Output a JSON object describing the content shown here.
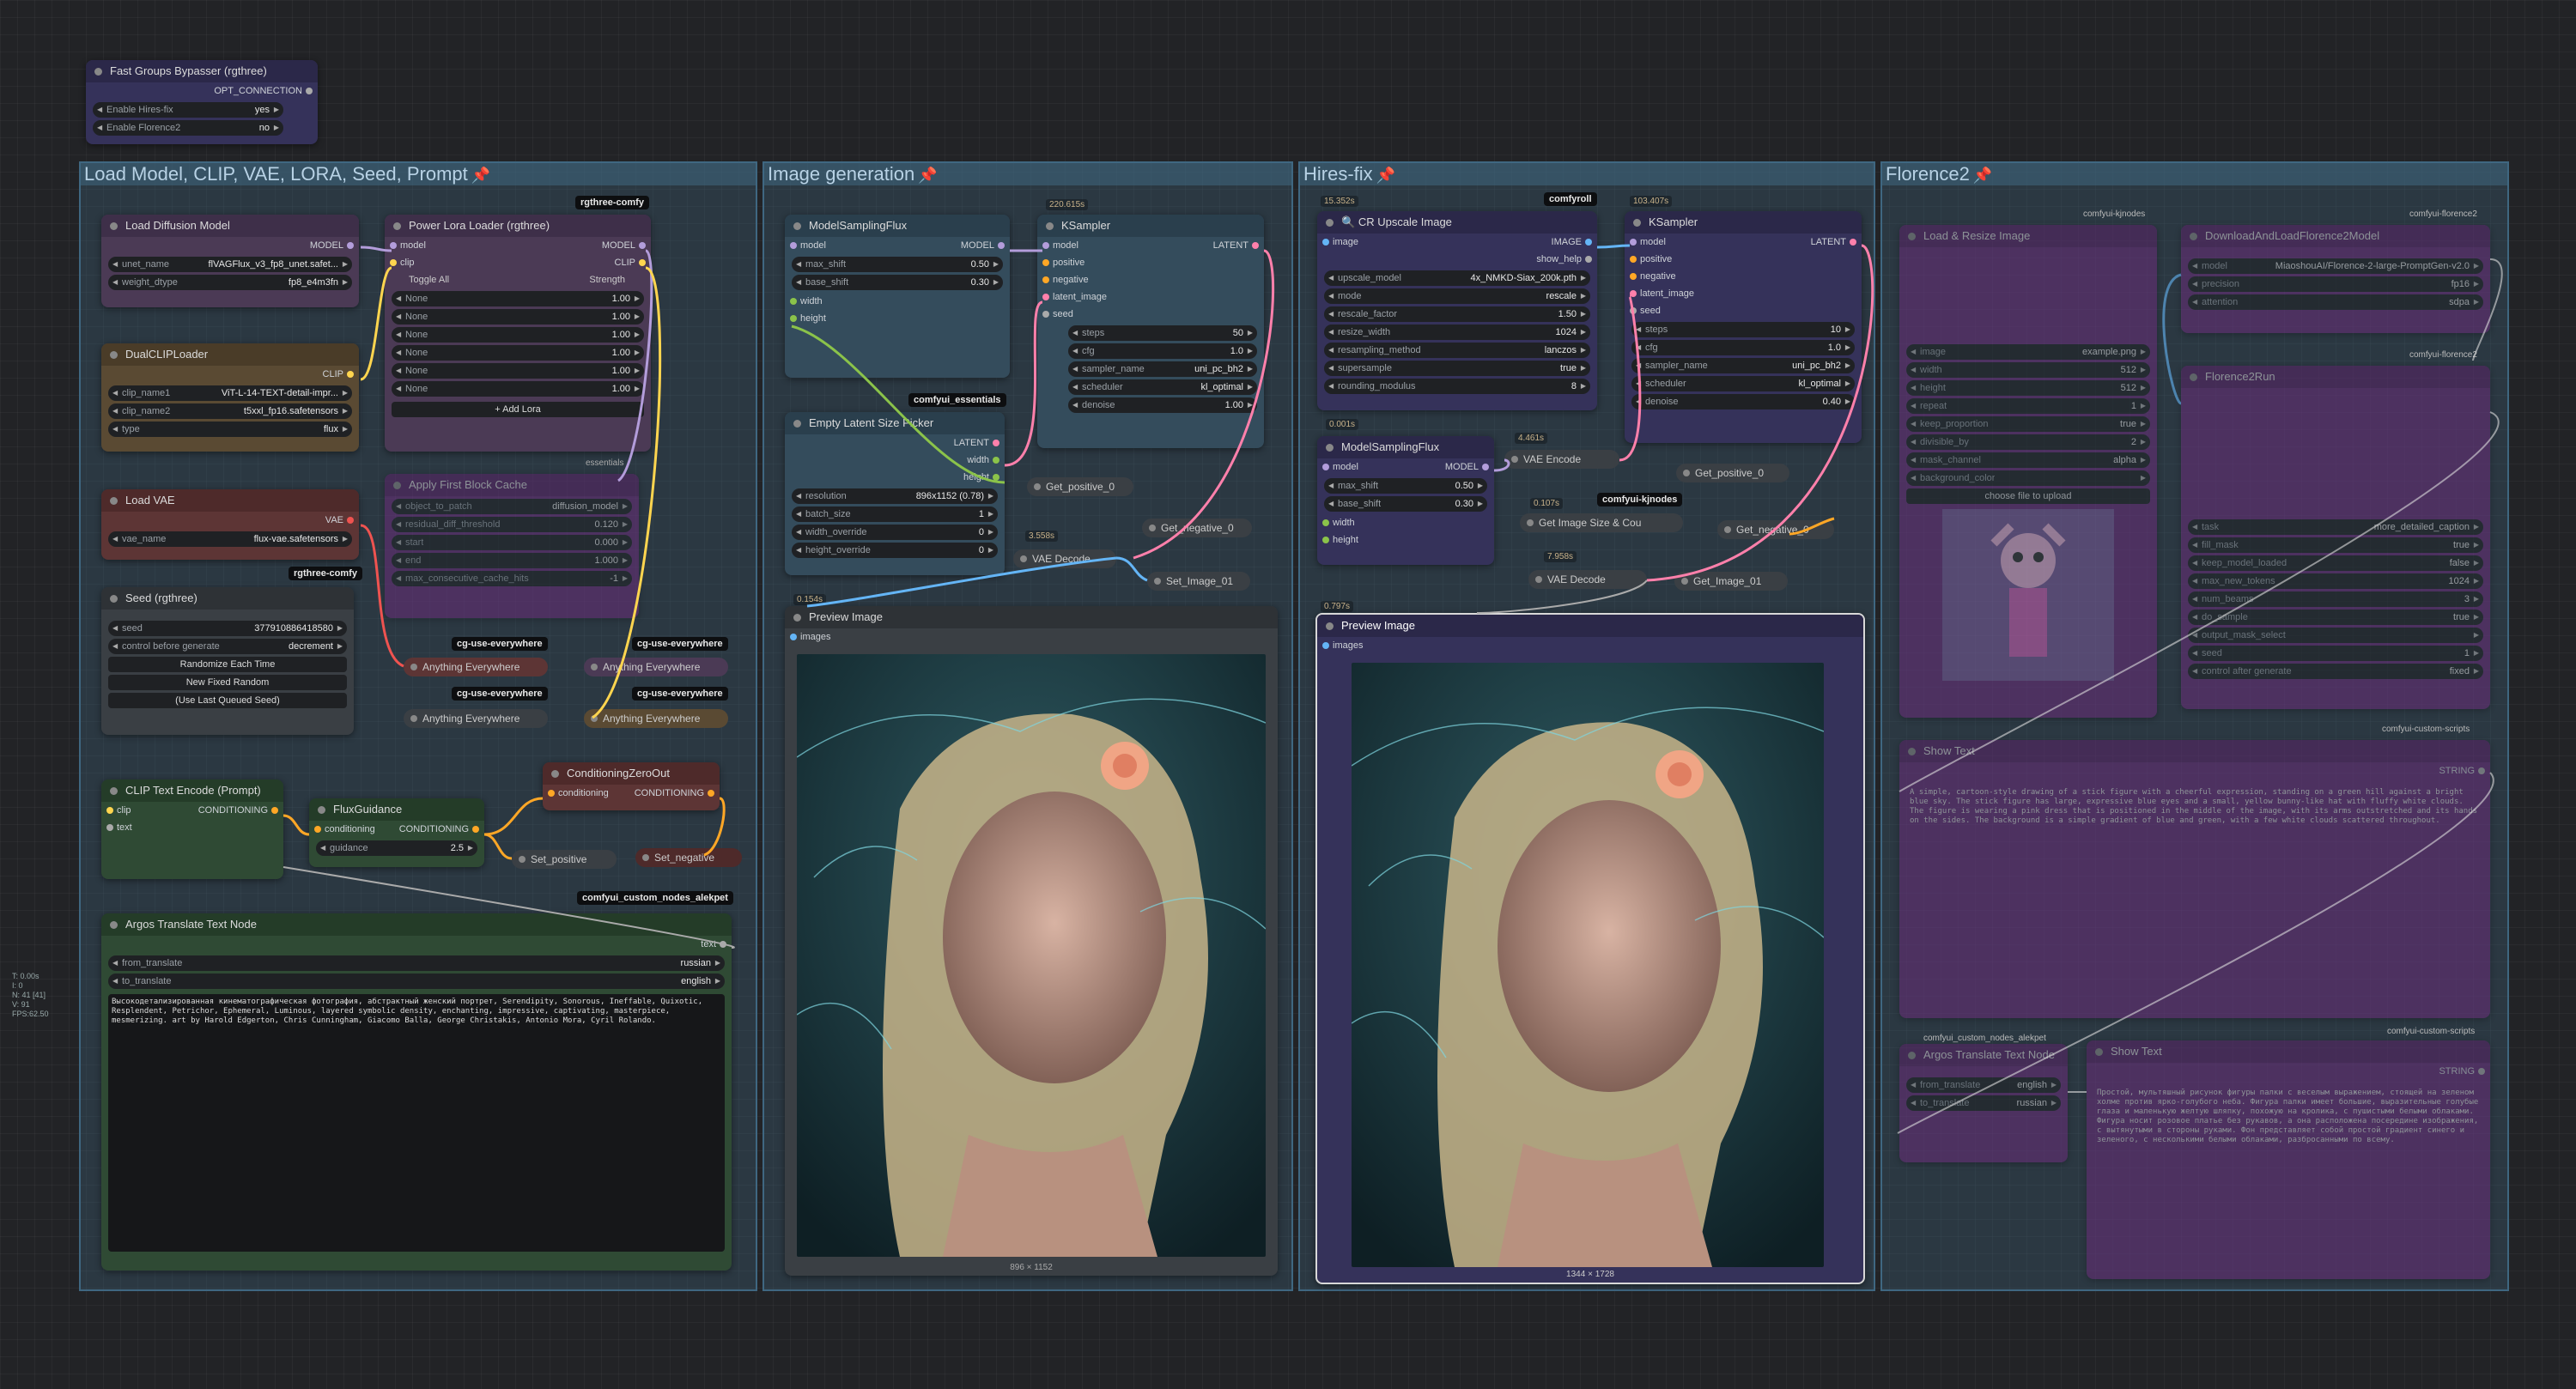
{
  "stats": [
    "T: 0.00s",
    "I: 0",
    "N: 41 [41]",
    "V: 91",
    "FPS:62.50"
  ],
  "groups": {
    "load": "Load Model, CLIP, VAE, LORA, Seed, Prompt",
    "gen": "Image generation",
    "hires": "Hires-fix",
    "florence": "Florence2"
  },
  "bypasser": {
    "title": "Fast Groups Bypasser (rgthree)",
    "out": "OPT_CONNECTION",
    "items": [
      {
        "label": "Enable Hires-fix",
        "value": "yes"
      },
      {
        "label": "Enable Florence2",
        "value": "no"
      }
    ]
  },
  "diffusion": {
    "title": "Load Diffusion Model",
    "out": "MODEL",
    "w": [
      [
        "unet_name",
        "flVAGFlux_v3_fp8_unet.safet..."
      ],
      [
        "weight_dtype",
        "fp8_e4m3fn"
      ]
    ]
  },
  "dualclip": {
    "title": "DualCLIPLoader",
    "out": "CLIP",
    "w": [
      [
        "clip_name1",
        "ViT-L-14-TEXT-detail-impr..."
      ],
      [
        "clip_name2",
        "t5xxl_fp16.safetensors"
      ],
      [
        "type",
        "flux"
      ]
    ]
  },
  "vae": {
    "title": "Load VAE",
    "out": "VAE",
    "w": [
      [
        "vae_name",
        "flux-vae.safetensors"
      ]
    ]
  },
  "seed": {
    "title": "Seed (rgthree)",
    "w": [
      [
        "seed",
        "377910886418580"
      ],
      [
        "control before generate",
        "decrement"
      ]
    ],
    "btns": [
      "Randomize Each Time",
      "New Fixed Random",
      "(Use Last Queued Seed)"
    ]
  },
  "lora": {
    "title": "Power Lora Loader (rgthree)",
    "in": [
      "model",
      "clip"
    ],
    "out": [
      "MODEL",
      "CLIP"
    ],
    "toggle": "Toggle All",
    "strength": "Strength",
    "rows": [
      "None",
      "None",
      "None",
      "None",
      "None",
      "None"
    ],
    "rowval": "1.00",
    "add": "+ Add Lora"
  },
  "fbc": {
    "title": "Apply First Block Cache",
    "w": [
      [
        "model",
        ""
      ],
      [
        "object_to_patch",
        "diffusion_model"
      ],
      [
        "residual_diff_threshold",
        "0.120"
      ],
      [
        "start",
        "0.000"
      ],
      [
        "end",
        "1.000"
      ],
      [
        "max_consecutive_cache_hits",
        "-1"
      ]
    ]
  },
  "anything": [
    "Anything Everywhere",
    "Anything Everywhere",
    "Anything Everywhere",
    "Anything Everywhere"
  ],
  "badges": {
    "rgthree": "rgthree-comfy",
    "cg": "cg-use-everywhere",
    "essentials": "comfyui_essentials",
    "comfyroll": "comfyroll",
    "kjnodes": "comfyui-kjnodes",
    "aleksei": "comfyui_custom_nodes_alekpet",
    "florence2": "comfyui-florence2",
    "customscripts": "comfyui-custom-scripts",
    "essentials2": "essentials"
  },
  "clipenc": {
    "title": "CLIP Text Encode (Prompt)",
    "in": [
      "clip",
      "text"
    ],
    "out": "CONDITIONING"
  },
  "fluxguid": {
    "title": "FluxGuidance",
    "in": "conditioning",
    "out": "CONDITIONING",
    "w": [
      [
        "guidance",
        "2.5"
      ]
    ]
  },
  "czo": {
    "title": "ConditioningZeroOut",
    "in": "conditioning",
    "out": "CONDITIONING"
  },
  "setpos": "Set_positive",
  "setneg": "Set_negative",
  "argos": {
    "title": "Argos Translate Text Node",
    "out": "text",
    "w": [
      [
        "from_translate",
        "russian"
      ],
      [
        "to_translate",
        "english"
      ]
    ],
    "text": "Высокодетализированная кинематографическая фотография, абстрактный женский портрет, Serendipity, Sonorous, Ineffable, Quixotic, Resplendent, Petrichor, Ephemeral, Luminous, layered symbolic density, enchanting, impressive, captivating, masterpiece, mesmerizing. art by Harold Edgerton, Chris Cunningham, Giacomo Balla, George Christakis, Antonio Mora, Cyril Rolando."
  },
  "msf1": {
    "title": "ModelSamplingFlux",
    "in": [
      "model",
      "width",
      "height"
    ],
    "out": "MODEL",
    "w": [
      [
        "max_shift",
        "0.50"
      ],
      [
        "base_shift",
        "0.30"
      ]
    ]
  },
  "ks1": {
    "title": "KSampler",
    "in": [
      "model",
      "positive",
      "negative",
      "latent_image",
      "seed"
    ],
    "out": "LATENT",
    "w": [
      [
        "steps",
        "50"
      ],
      [
        "cfg",
        "1.0"
      ],
      [
        "sampler_name",
        "uni_pc_bh2"
      ],
      [
        "scheduler",
        "kl_optimal"
      ],
      [
        "denoise",
        "1.00"
      ]
    ],
    "time": "220.615s"
  },
  "elsp": {
    "title": "Empty Latent Size Picker",
    "out": [
      "LATENT",
      "width",
      "height"
    ],
    "w": [
      [
        "resolution",
        "896x1152 (0.78)"
      ],
      [
        "batch_size",
        "1"
      ],
      [
        "width_override",
        "0"
      ],
      [
        "height_override",
        "0"
      ]
    ]
  },
  "getpos0": "Get_positive_0",
  "getneg0": "Get_negative_0",
  "vaedec1": {
    "title": "VAE Decode",
    "time": "3.558s"
  },
  "setimg": "Set_Image_01",
  "prev1": {
    "title": "Preview Image",
    "in": "images",
    "size": "896 × 1152",
    "time": "0.154s"
  },
  "cr": {
    "title": "CR Upscale Image",
    "in": "image",
    "out": [
      "IMAGE",
      "show_help"
    ],
    "w": [
      [
        "upscale_model",
        "4x_NMKD-Siax_200k.pth"
      ],
      [
        "mode",
        "rescale"
      ],
      [
        "rescale_factor",
        "1.50"
      ],
      [
        "resize_width",
        "1024"
      ],
      [
        "resampling_method",
        "lanczos"
      ],
      [
        "supersample",
        "true"
      ],
      [
        "rounding_modulus",
        "8"
      ]
    ],
    "time": "15.352s"
  },
  "msf2": {
    "title": "ModelSamplingFlux",
    "in": [
      "model",
      "width",
      "height"
    ],
    "out": "MODEL",
    "w": [
      [
        "max_shift",
        "0.50"
      ],
      [
        "base_shift",
        "0.30"
      ]
    ],
    "time": "0.001s"
  },
  "ks2": {
    "title": "KSampler",
    "in": [
      "model",
      "positive",
      "negative",
      "latent_image",
      "seed"
    ],
    "out": "LATENT",
    "w": [
      [
        "steps",
        "10"
      ],
      [
        "cfg",
        "1.0"
      ],
      [
        "sampler_name",
        "uni_pc_bh2"
      ],
      [
        "scheduler",
        "kl_optimal"
      ],
      [
        "denoise",
        "0.40"
      ]
    ],
    "time": "103.407s"
  },
  "vaeenc": {
    "title": "VAE Encode",
    "time": "4.461s"
  },
  "getimgsize": {
    "title": "Get Image Size & Cou",
    "time": "0.107s"
  },
  "vaedec2": {
    "title": "VAE Decode",
    "time": "7.958s"
  },
  "getimg01": "Get_Image_01",
  "getpos2": "Get_positive_0",
  "getneg2": "Get_negative_0",
  "prev2": {
    "title": "Preview Image",
    "in": "images",
    "size": "1344 × 1728",
    "time": "0.797s"
  },
  "flo": {
    "load": {
      "title": "Load & Resize Image",
      "w": [
        [
          "image",
          "example.png"
        ],
        [
          "width",
          "512"
        ],
        [
          "height",
          "512"
        ],
        [
          "repeat",
          "1"
        ],
        [
          "keep_proportion",
          "true"
        ],
        [
          "divisible_by",
          "2"
        ],
        [
          "mask_channel",
          "alpha"
        ],
        [
          "background_color",
          ""
        ]
      ],
      "upload": "choose file to upload"
    },
    "dl": {
      "title": "DownloadAndLoadFlorence2Model",
      "w": [
        [
          "model",
          "MiaoshouAI/Florence-2-large-PromptGen-v2.0"
        ],
        [
          "precision",
          "fp16"
        ],
        [
          "attention",
          "sdpa"
        ]
      ]
    },
    "run": {
      "title": "Florence2Run",
      "w": [
        [
          "task",
          "more_detailed_caption"
        ],
        [
          "fill_mask",
          "true"
        ],
        [
          "keep_model_loaded",
          "false"
        ],
        [
          "max_new_tokens",
          "1024"
        ],
        [
          "num_beams",
          "3"
        ],
        [
          "do_sample",
          "true"
        ],
        [
          "output_mask_select",
          ""
        ],
        [
          "seed",
          "1"
        ],
        [
          "control after generate",
          "fixed"
        ]
      ]
    },
    "show1": {
      "title": "Show Text",
      "out": "STRING",
      "text": "A simple, cartoon-style drawing of a stick figure with a cheerful expression, standing on a green hill against a bright blue sky. The stick figure has large, expressive blue eyes and a small, yellow bunny-like hat with fluffy white clouds. The figure is wearing a pink dress that is positioned in the middle of the image, with its arms outstretched and its hands on the sides. The background is a simple gradient of blue and green, with a few white clouds scattered throughout."
    },
    "argos2": {
      "title": "Argos Translate Text Node",
      "w": [
        [
          "from_translate",
          "english"
        ],
        [
          "to_translate",
          "russian"
        ]
      ]
    },
    "show2": {
      "title": "Show Text",
      "out": "STRING",
      "text": "Простой, мультяшный рисунок фигуры палки с веселым выражением, стоящей на зеленом холме против ярко-голубого неба. Фигура палки имеет большие, выразительные голубые глаза и маленькую желтую шляпку, похожую на кролика, с пушистыми белыми облаками. Фигура носит розовое платье без рукавов, а она расположена посередине изображения, с вытянутыми в стороны руками. Фон представляет собой простой градиент синего и зеленого, с несколькими белыми облаками, разбросанными по всему."
    }
  }
}
